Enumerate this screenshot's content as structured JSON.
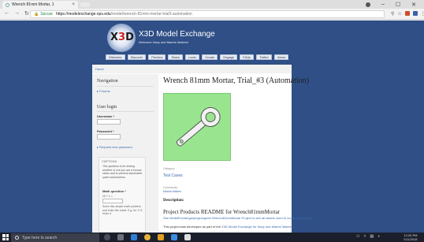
{
  "browser": {
    "tab_title": "Wrench 81mm Mortar, 1",
    "tab_close": "×",
    "secure_label": "Secure",
    "url_host": "https://modelexchange.nps.edu",
    "url_path": "/model/wrench-81mm-mortar-trial3-automation",
    "window_controls": [
      "–",
      "☐",
      "✕"
    ]
  },
  "site": {
    "name": "X3D Model Exchange",
    "slogan": "Welcome Navy and Marine Makers!",
    "logo_text": "X3D",
    "menu": [
      "Welcome",
      "Discover",
      "Preview",
      "Share",
      "Learn",
      "Create",
      "Engage",
      "FAQs",
      "Twitter",
      "About"
    ]
  },
  "breadcrumb": "Home",
  "sidebar": {
    "navigation_title": "Navigation",
    "forums_link": "Forums",
    "login_title": "User login",
    "username_label": "Username *",
    "password_label": "Password *",
    "request_password": "Request new password",
    "captcha": {
      "legend": "CAPTCHA",
      "description": "This question is for testing whether or not you are a human visitor and to prevent automated spam submissions.",
      "math_label": "Math question *",
      "problem": "10 + 1 =",
      "hint": "Solve this simple math problem and enter the result. E.g. for 1+3, enter 4."
    }
  },
  "main": {
    "title": "Wrench 81mm Mortar, Trial_#3 (Automation)",
    "category_label": "Category:",
    "category_link": "Test Cases",
    "community_label": "Community:",
    "community_link": "Marine Makers",
    "description_label": "Description:",
    "readme_title": "Project Products README for Wrench81mmMortar",
    "see_text": "See ModelExchange/plugins/gram Wrench81mmMortar Project to see all assets used to create this project.",
    "dev_text_before": "This project was developed as part of the ",
    "dev_link": "X3D Model Exchange for Navy and Marine Makers",
    "dev_text_after": "."
  },
  "taskbar": {
    "search_placeholder": "Type here to search",
    "time": "12:20 PM",
    "date": "1/11/2018"
  },
  "colors": {
    "page_bg": "#2f4f86",
    "model_bg": "#99e58f",
    "link": "#3a6bb0"
  }
}
